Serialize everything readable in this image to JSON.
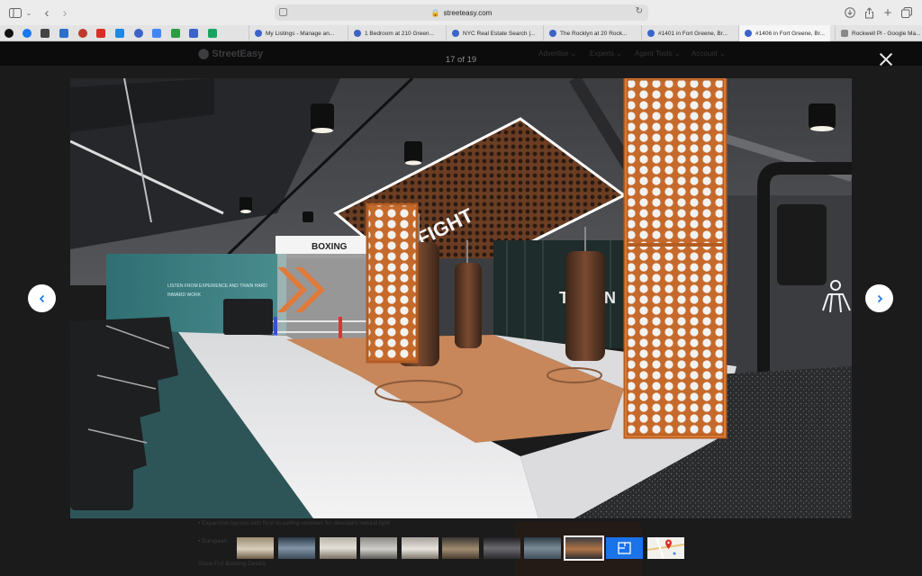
{
  "browser": {
    "url": "streeteasy.com",
    "tabs": [
      {
        "label": "My Listings - Manage an...",
        "favicon_color": "#3a64c8"
      },
      {
        "label": "1 Bedroom at 210 Green...",
        "favicon_color": "#3a64c8"
      },
      {
        "label": "NYC Real Estate Search |...",
        "favicon_color": "#3a64c8"
      },
      {
        "label": "The Rocklyn at 20 Rock...",
        "favicon_color": "#3a64c8"
      },
      {
        "label": "#1401 in Fort Greene, Br...",
        "favicon_color": "#3a64c8"
      },
      {
        "label": "#1406 in Fort Greene, Br...",
        "favicon_color": "#3a64c8",
        "active": true
      },
      {
        "label": "Rockwell Pl - Google Ma...",
        "favicon_color": "#888888"
      }
    ],
    "pinned_favicons": [
      "#111111",
      "#1877f2",
      "#444444",
      "#2c6ecb",
      "#c0392b",
      "#d93025",
      "#1e88e5",
      "#3a64c8",
      "#4285f4",
      "#2d9c46",
      "#3a64c8",
      "#1aa260"
    ]
  },
  "site": {
    "logo": "StreetEasy",
    "nav": [
      "Advertise",
      "Experts",
      "Agent Tools",
      "Account"
    ]
  },
  "lightbox": {
    "counter": "17 of 19",
    "close_label": "close",
    "prev_label": "previous photo",
    "next_label": "next photo",
    "photo_signs": {
      "boxing": "BOXING",
      "fight": "FIGHT",
      "wall_sign": "THEON",
      "wall_text_1": "LISTEN FROM EXPERIENCE AND TRAIN HARD",
      "wall_text_2": "INWARD WORK"
    },
    "thumbnail_count": 11,
    "selected_thumbnail": 9
  },
  "background_text": {
    "line1": "• Expansive layouts with floor-to-ceiling windows for abundant natural light",
    "line2": "• European",
    "link": "Show Full Building Details"
  },
  "colors": {
    "accent_blue": "#1a73e8",
    "overlay": "#1b1b1c"
  }
}
